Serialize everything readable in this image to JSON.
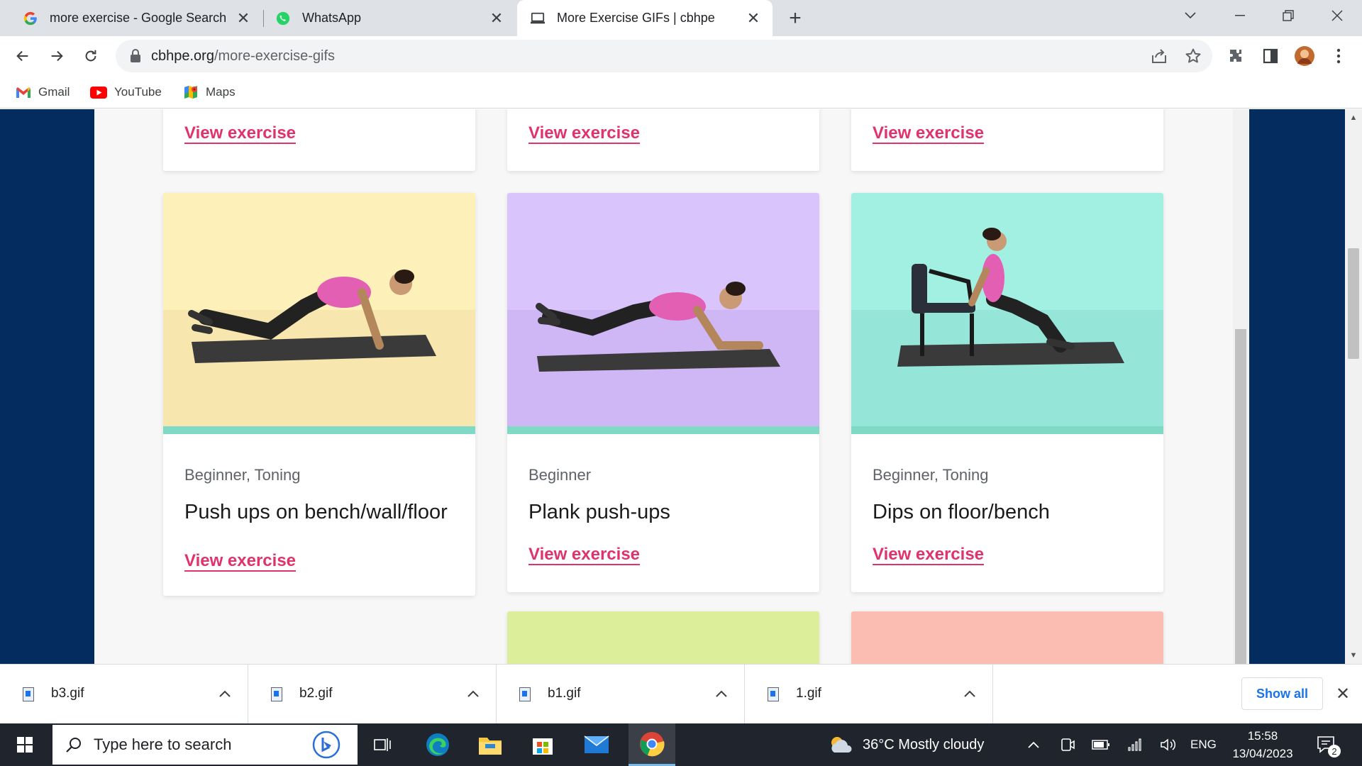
{
  "browser": {
    "tabs": [
      {
        "title": "more exercise - Google Search",
        "favicon": "google-g-icon",
        "active": false
      },
      {
        "title": "WhatsApp",
        "favicon": "whatsapp-icon",
        "active": false
      },
      {
        "title": "More Exercise GIFs | cbhpe",
        "favicon": "laptop-icon",
        "active": true
      }
    ],
    "url_host": "cbhpe.org",
    "url_path": "/more-exercise-gifs",
    "bookmarks": [
      {
        "label": "Gmail",
        "icon": "gmail-icon"
      },
      {
        "label": "YouTube",
        "icon": "youtube-icon"
      },
      {
        "label": "Maps",
        "icon": "maps-icon"
      }
    ]
  },
  "page": {
    "link_label": "View exercise",
    "cards": [
      {
        "tags": "Beginner, Toning",
        "name": "Push ups on bench/wall/floor",
        "bg": "#fdf0b8",
        "bg2": "#f8e6af"
      },
      {
        "tags": "Beginner",
        "name": "Plank push-ups",
        "bg": "#d9c4fb",
        "bg2": "#cfb6f5"
      },
      {
        "tags": "Beginner, Toning",
        "name": "Dips on floor/bench",
        "bg": "#a2f0e1",
        "bg2": "#95e6d8"
      }
    ],
    "next_row_colors": [
      "#dcee9a",
      "#fbbdb2"
    ]
  },
  "downloads": {
    "files": [
      "b3.gif",
      "b2.gif",
      "b1.gif",
      "1.gif"
    ],
    "show_all": "Show all"
  },
  "taskbar": {
    "search_placeholder": "Type here to search",
    "weather": "36°C  Mostly cloudy",
    "language": "ENG",
    "time": "15:58",
    "date": "13/04/2023",
    "notification_count": "2"
  }
}
